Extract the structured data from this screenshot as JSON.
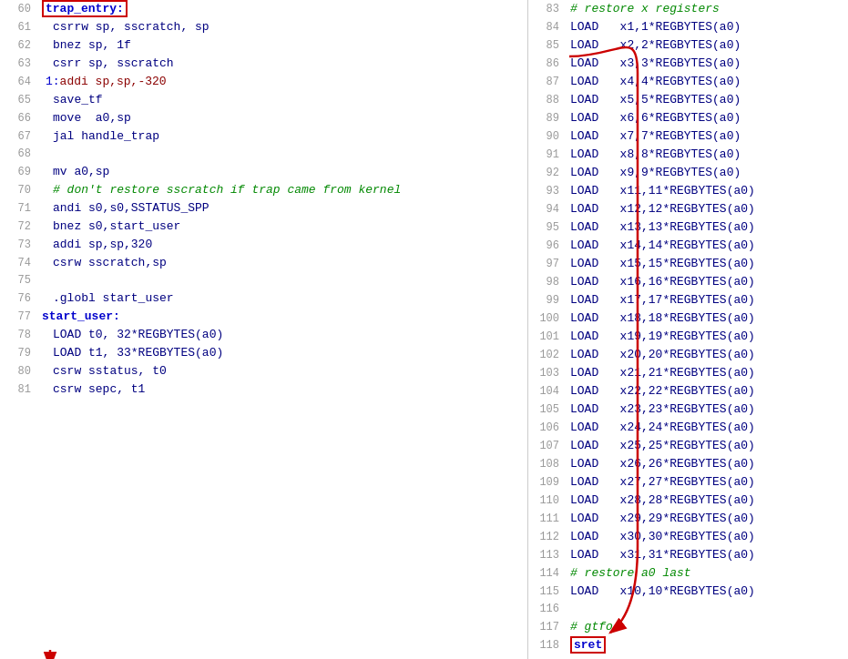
{
  "left_lines": [
    {
      "num": "60",
      "tokens": [
        {
          "t": "trap_entry:",
          "cls": "c-label c-highlight-box"
        }
      ]
    },
    {
      "num": "61",
      "indent": 4,
      "tokens": [
        {
          "t": "csrrw sp, sscratch, sp",
          "cls": "c-instr"
        }
      ]
    },
    {
      "num": "62",
      "indent": 4,
      "tokens": [
        {
          "t": "bnez sp, 1f",
          "cls": "c-instr"
        }
      ]
    },
    {
      "num": "63",
      "indent": 4,
      "tokens": [
        {
          "t": "csrr sp, sscratch",
          "cls": "c-instr"
        }
      ]
    },
    {
      "num": "64",
      "indent": 2,
      "tokens": [
        {
          "t": "1:",
          "cls": "c-blue-label"
        },
        {
          "t": "addi sp,sp,-320",
          "cls": "c-macro"
        }
      ]
    },
    {
      "num": "65",
      "indent": 4,
      "tokens": [
        {
          "t": "save_tf",
          "cls": "c-instr"
        }
      ]
    },
    {
      "num": "66",
      "indent": 4,
      "tokens": [
        {
          "t": "move  a0,sp",
          "cls": "c-instr"
        }
      ]
    },
    {
      "num": "67",
      "indent": 4,
      "tokens": [
        {
          "t": "jal handle_trap",
          "cls": "c-instr"
        }
      ]
    },
    {
      "num": "68",
      "tokens": []
    },
    {
      "num": "69",
      "indent": 4,
      "tokens": [
        {
          "t": "mv a0,sp",
          "cls": "c-instr"
        }
      ]
    },
    {
      "num": "70",
      "indent": 4,
      "tokens": [
        {
          "t": "# don't restore sscratch if trap came from kernel",
          "cls": "c-comment"
        }
      ]
    },
    {
      "num": "71",
      "indent": 4,
      "tokens": [
        {
          "t": "andi s0,s0,SSTATUS_SPP",
          "cls": "c-instr"
        }
      ]
    },
    {
      "num": "72",
      "indent": 4,
      "tokens": [
        {
          "t": "bnez s0,start_user",
          "cls": "c-instr"
        }
      ]
    },
    {
      "num": "73",
      "indent": 4,
      "tokens": [
        {
          "t": "addi sp,sp,320",
          "cls": "c-instr"
        }
      ]
    },
    {
      "num": "74",
      "indent": 4,
      "tokens": [
        {
          "t": "csrw sscratch,sp",
          "cls": "c-instr"
        }
      ]
    },
    {
      "num": "75",
      "tokens": []
    },
    {
      "num": "76",
      "indent": 4,
      "tokens": [
        {
          "t": ".globl start_user",
          "cls": "c-instr"
        }
      ]
    },
    {
      "num": "77",
      "tokens": [
        {
          "t": "start_user:",
          "cls": "c-label"
        }
      ]
    },
    {
      "num": "78",
      "indent": 4,
      "tokens": [
        {
          "t": "LOAD t0, 32*REGBYTES(a0)",
          "cls": "c-instr"
        }
      ]
    },
    {
      "num": "79",
      "indent": 4,
      "tokens": [
        {
          "t": "LOAD t1, 33*REGBYTES(a0)",
          "cls": "c-instr"
        }
      ]
    },
    {
      "num": "80",
      "indent": 4,
      "tokens": [
        {
          "t": "csrw sstatus, t0",
          "cls": "c-instr"
        }
      ]
    },
    {
      "num": "81",
      "indent": 4,
      "tokens": [
        {
          "t": "csrw sepc, t1",
          "cls": "c-instr"
        }
      ]
    }
  ],
  "right_lines": [
    {
      "num": "83",
      "tokens": [
        {
          "t": "# restore x registers",
          "cls": "c-comment"
        }
      ]
    },
    {
      "num": "84",
      "tokens": [
        {
          "t": "LOAD   x1,1*REGBYTES(a0)",
          "cls": "c-instr"
        }
      ]
    },
    {
      "num": "85",
      "tokens": [
        {
          "t": "LOAD   x2,2*REGBYTES(a0)",
          "cls": "c-instr"
        }
      ]
    },
    {
      "num": "86",
      "tokens": [
        {
          "t": "LOAD   x3,3*REGBYTES(a0)",
          "cls": "c-instr"
        }
      ]
    },
    {
      "num": "87",
      "tokens": [
        {
          "t": "LOAD   x4,4*REGBYTES(a0)",
          "cls": "c-instr"
        }
      ]
    },
    {
      "num": "88",
      "tokens": [
        {
          "t": "LOAD   x5,5*REGBYTES(a0)",
          "cls": "c-instr"
        }
      ]
    },
    {
      "num": "89",
      "tokens": [
        {
          "t": "LOAD   x6,6*REGBYTES(a0)",
          "cls": "c-instr"
        }
      ]
    },
    {
      "num": "90",
      "tokens": [
        {
          "t": "LOAD   x7,7*REGBYTES(a0)",
          "cls": "c-instr"
        }
      ]
    },
    {
      "num": "91",
      "tokens": [
        {
          "t": "LOAD   x8,8*REGBYTES(a0)",
          "cls": "c-instr"
        }
      ]
    },
    {
      "num": "92",
      "tokens": [
        {
          "t": "LOAD   x9,9*REGBYTES(a0)",
          "cls": "c-instr"
        }
      ]
    },
    {
      "num": "93",
      "tokens": [
        {
          "t": "LOAD   x11,11*REGBYTES(a0)",
          "cls": "c-instr"
        }
      ]
    },
    {
      "num": "94",
      "tokens": [
        {
          "t": "LOAD   x12,12*REGBYTES(a0)",
          "cls": "c-instr"
        }
      ]
    },
    {
      "num": "95",
      "tokens": [
        {
          "t": "LOAD   x13,13*REGBYTES(a0)",
          "cls": "c-instr"
        }
      ]
    },
    {
      "num": "96",
      "tokens": [
        {
          "t": "LOAD   x14,14*REGBYTES(a0)",
          "cls": "c-instr"
        }
      ]
    },
    {
      "num": "97",
      "tokens": [
        {
          "t": "LOAD   x15,15*REGBYTES(a0)",
          "cls": "c-instr"
        }
      ]
    },
    {
      "num": "98",
      "tokens": [
        {
          "t": "LOAD   x16,16*REGBYTES(a0)",
          "cls": "c-instr"
        }
      ]
    },
    {
      "num": "99",
      "tokens": [
        {
          "t": "LOAD   x17,17*REGBYTES(a0)",
          "cls": "c-instr"
        }
      ]
    },
    {
      "num": "100",
      "tokens": [
        {
          "t": "LOAD   x18,18*REGBYTES(a0)",
          "cls": "c-instr"
        }
      ]
    },
    {
      "num": "101",
      "tokens": [
        {
          "t": "LOAD   x19,19*REGBYTES(a0)",
          "cls": "c-instr"
        }
      ]
    },
    {
      "num": "102",
      "tokens": [
        {
          "t": "LOAD   x20,20*REGBYTES(a0)",
          "cls": "c-instr"
        }
      ]
    },
    {
      "num": "103",
      "tokens": [
        {
          "t": "LOAD   x21,21*REGBYTES(a0)",
          "cls": "c-instr"
        }
      ]
    },
    {
      "num": "104",
      "tokens": [
        {
          "t": "LOAD   x22,22*REGBYTES(a0)",
          "cls": "c-instr"
        }
      ]
    },
    {
      "num": "105",
      "tokens": [
        {
          "t": "LOAD   x23,23*REGBYTES(a0)",
          "cls": "c-instr"
        }
      ]
    },
    {
      "num": "106",
      "tokens": [
        {
          "t": "LOAD   x24,24*REGBYTES(a0)",
          "cls": "c-instr"
        }
      ]
    },
    {
      "num": "107",
      "tokens": [
        {
          "t": "LOAD   x25,25*REGBYTES(a0)",
          "cls": "c-instr"
        }
      ]
    },
    {
      "num": "108",
      "tokens": [
        {
          "t": "LOAD   x26,26*REGBYTES(a0)",
          "cls": "c-instr"
        }
      ]
    },
    {
      "num": "109",
      "tokens": [
        {
          "t": "LOAD   x27,27*REGBYTES(a0)",
          "cls": "c-instr"
        }
      ]
    },
    {
      "num": "110",
      "tokens": [
        {
          "t": "LOAD   x28,28*REGBYTES(a0)",
          "cls": "c-instr"
        }
      ]
    },
    {
      "num": "111",
      "tokens": [
        {
          "t": "LOAD   x29,29*REGBYTES(a0)",
          "cls": "c-instr"
        }
      ]
    },
    {
      "num": "112",
      "tokens": [
        {
          "t": "LOAD   x30,30*REGBYTES(a0)",
          "cls": "c-instr"
        }
      ]
    },
    {
      "num": "113",
      "tokens": [
        {
          "t": "LOAD   x31,31*REGBYTES(a0)",
          "cls": "c-instr"
        }
      ]
    },
    {
      "num": "114",
      "tokens": [
        {
          "t": "# restore a0 last",
          "cls": "c-comment"
        }
      ]
    },
    {
      "num": "115",
      "tokens": [
        {
          "t": "LOAD   x10,10*REGBYTES(a0)",
          "cls": "c-instr"
        }
      ]
    },
    {
      "num": "116",
      "tokens": []
    },
    {
      "num": "117",
      "tokens": [
        {
          "t": "# gtfo",
          "cls": "c-comment"
        }
      ]
    },
    {
      "num": "118",
      "tokens": [
        {
          "t": "sret",
          "cls": "c-label c-highlight-box"
        }
      ]
    }
  ]
}
